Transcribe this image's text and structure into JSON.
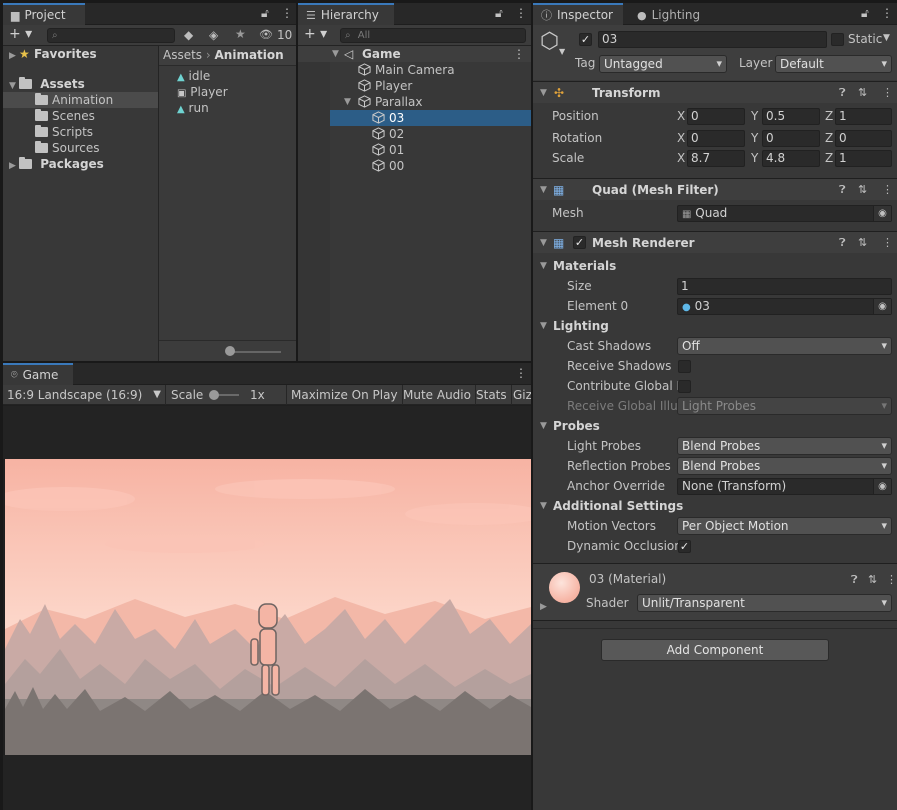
{
  "project": {
    "tab_label": "Project",
    "search_placeholder": "",
    "hidden_count": "10",
    "tree": {
      "favorites": "Favorites",
      "assets": "Assets",
      "asset_children": [
        "Animation",
        "Scenes",
        "Scripts",
        "Sources"
      ],
      "packages": "Packages"
    },
    "breadcrumb": [
      "Assets",
      "Animation"
    ],
    "files": [
      "idle",
      "Player",
      "run"
    ]
  },
  "hierarchy": {
    "tab_label": "Hierarchy",
    "search_placeholder": "All",
    "scene": "Game",
    "items": [
      {
        "label": "Main Camera",
        "depth": 1
      },
      {
        "label": "Player",
        "depth": 1
      },
      {
        "label": "Parallax",
        "depth": 1,
        "expanded": true
      },
      {
        "label": "03",
        "depth": 2,
        "selected": true
      },
      {
        "label": "02",
        "depth": 2
      },
      {
        "label": "01",
        "depth": 2
      },
      {
        "label": "00",
        "depth": 2
      }
    ]
  },
  "game": {
    "tab_label": "Game",
    "aspect": "16:9 Landscape (16:9)",
    "scale_label": "Scale",
    "scale_value": "1x",
    "maximize": "Maximize On Play",
    "mute": "Mute Audio",
    "stats": "Stats",
    "gizmos": "Giz"
  },
  "inspector": {
    "tab_label": "Inspector",
    "lighting_tab": "Lighting",
    "object_name": "03",
    "static_label": "Static",
    "tag_label": "Tag",
    "tag_value": "Untagged",
    "layer_label": "Layer",
    "layer_value": "Default",
    "transform": {
      "title": "Transform",
      "position_label": "Position",
      "rotation_label": "Rotation",
      "scale_label": "Scale",
      "position": {
        "x": "0",
        "y": "0.5",
        "z": "1"
      },
      "rotation": {
        "x": "0",
        "y": "0",
        "z": "0"
      },
      "scale": {
        "x": "8.7",
        "y": "4.8",
        "z": "1"
      },
      "axis": {
        "x": "X",
        "y": "Y",
        "z": "Z"
      }
    },
    "mesh_filter": {
      "title": "Quad (Mesh Filter)",
      "mesh_label": "Mesh",
      "mesh_value": "Quad"
    },
    "mesh_renderer": {
      "title": "Mesh Renderer",
      "materials_label": "Materials",
      "size_label": "Size",
      "size_value": "1",
      "element0_label": "Element 0",
      "element0_value": "03",
      "lighting_label": "Lighting",
      "cast_shadows_label": "Cast Shadows",
      "cast_shadows_value": "Off",
      "receive_shadows_label": "Receive Shadows",
      "contribute_gi_label": "Contribute Global Il",
      "receive_gi_label": "Receive Global Illur",
      "receive_gi_value": "Light Probes",
      "probes_label": "Probes",
      "light_probes_label": "Light Probes",
      "light_probes_value": "Blend Probes",
      "reflection_probes_label": "Reflection Probes",
      "reflection_probes_value": "Blend Probes",
      "anchor_override_label": "Anchor Override",
      "anchor_override_value": "None (Transform)",
      "additional_label": "Additional Settings",
      "motion_vectors_label": "Motion Vectors",
      "motion_vectors_value": "Per Object Motion",
      "dynamic_occlusion_label": "Dynamic Occlusion"
    },
    "material": {
      "title": "03 (Material)",
      "shader_label": "Shader",
      "shader_value": "Unlit/Transparent"
    },
    "add_component": "Add Component"
  },
  "colors": {
    "accent": "#3a79bb",
    "selection": "#2c5d87",
    "sky_top": "#f6b3a3",
    "sky_bottom": "#fde3da"
  }
}
